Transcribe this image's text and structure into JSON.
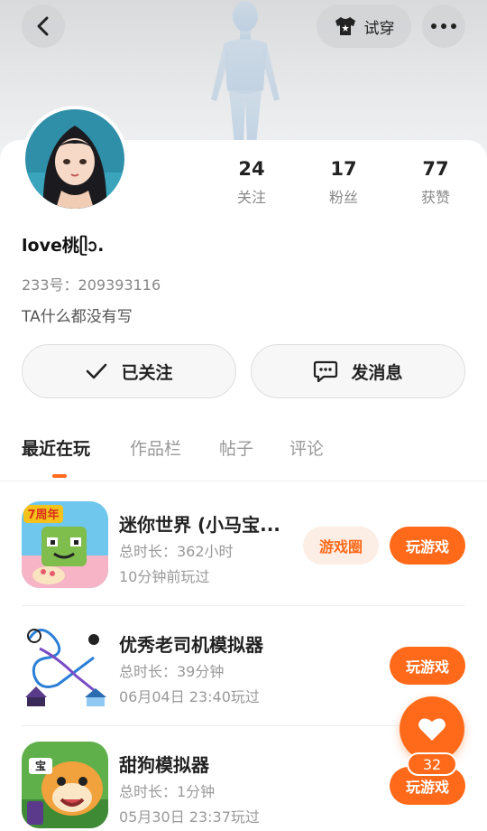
{
  "header": {
    "try_on_label": "试穿",
    "back_icon": "chevron-left-icon",
    "more_icon": "more-dots-icon",
    "try_on_icon": "tshirt-icon"
  },
  "profile": {
    "nickname": "love桃ᥫᩣ.",
    "uid": "233号：209393116",
    "bio": "TA什么都没有写"
  },
  "stats": [
    {
      "value": "24",
      "label": "关注"
    },
    {
      "value": "17",
      "label": "粉丝"
    },
    {
      "value": "77",
      "label": "获赞"
    }
  ],
  "actions": {
    "followed_label": "已关注",
    "message_label": "发消息"
  },
  "tabs": [
    {
      "label": "最近在玩",
      "active": true
    },
    {
      "label": "作品栏",
      "active": false
    },
    {
      "label": "帖子",
      "active": false
    },
    {
      "label": "评论",
      "active": false
    }
  ],
  "games": [
    {
      "title": "迷你世界 (小马宝...",
      "duration": "总时长：362小时",
      "last_played": "10分钟前玩过",
      "circle_label": "游戏圈",
      "play_label": "玩游戏",
      "badge": "7周年"
    },
    {
      "title": "优秀老司机模拟器",
      "duration": "总时长：39分钟",
      "last_played": "06月04日 23:40玩过",
      "play_label": "玩游戏"
    },
    {
      "title": "甜狗模拟器",
      "duration": "总时长：1分钟",
      "last_played": "05月30日 23:37玩过",
      "play_label": "玩游戏",
      "badge": "宝"
    }
  ],
  "like_fab": {
    "count": "32",
    "icon": "heart-icon"
  },
  "colors": {
    "accent": "#ff6a1a",
    "accent_light": "#fdeee5"
  }
}
